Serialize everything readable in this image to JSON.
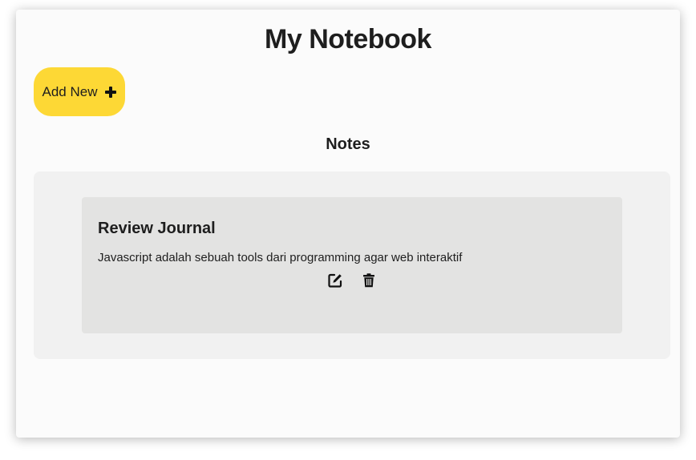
{
  "header": {
    "title": "My Notebook"
  },
  "toolbar": {
    "add_label": "Add New",
    "add_icon": "plus-icon",
    "accent_color": "#fdd835"
  },
  "notes_section": {
    "title": "Notes",
    "notes": [
      {
        "title": "Review Journal",
        "body": "Javascript adalah sebuah tools dari programming agar web interaktif",
        "actions": [
          "edit-icon",
          "trash-icon"
        ]
      }
    ]
  }
}
